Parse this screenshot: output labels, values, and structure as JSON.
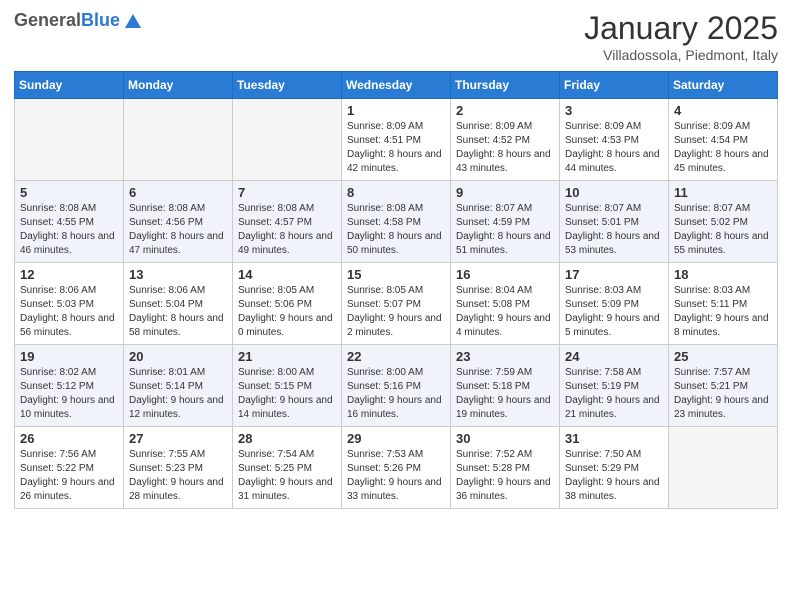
{
  "header": {
    "logo_general": "General",
    "logo_blue": "Blue",
    "title": "January 2025",
    "location": "Villadossola, Piedmont, Italy"
  },
  "days_of_week": [
    "Sunday",
    "Monday",
    "Tuesday",
    "Wednesday",
    "Thursday",
    "Friday",
    "Saturday"
  ],
  "weeks": [
    [
      {
        "day": "",
        "info": ""
      },
      {
        "day": "",
        "info": ""
      },
      {
        "day": "",
        "info": ""
      },
      {
        "day": "1",
        "info": "Sunrise: 8:09 AM\nSunset: 4:51 PM\nDaylight: 8 hours and 42 minutes."
      },
      {
        "day": "2",
        "info": "Sunrise: 8:09 AM\nSunset: 4:52 PM\nDaylight: 8 hours and 43 minutes."
      },
      {
        "day": "3",
        "info": "Sunrise: 8:09 AM\nSunset: 4:53 PM\nDaylight: 8 hours and 44 minutes."
      },
      {
        "day": "4",
        "info": "Sunrise: 8:09 AM\nSunset: 4:54 PM\nDaylight: 8 hours and 45 minutes."
      }
    ],
    [
      {
        "day": "5",
        "info": "Sunrise: 8:08 AM\nSunset: 4:55 PM\nDaylight: 8 hours and 46 minutes."
      },
      {
        "day": "6",
        "info": "Sunrise: 8:08 AM\nSunset: 4:56 PM\nDaylight: 8 hours and 47 minutes."
      },
      {
        "day": "7",
        "info": "Sunrise: 8:08 AM\nSunset: 4:57 PM\nDaylight: 8 hours and 49 minutes."
      },
      {
        "day": "8",
        "info": "Sunrise: 8:08 AM\nSunset: 4:58 PM\nDaylight: 8 hours and 50 minutes."
      },
      {
        "day": "9",
        "info": "Sunrise: 8:07 AM\nSunset: 4:59 PM\nDaylight: 8 hours and 51 minutes."
      },
      {
        "day": "10",
        "info": "Sunrise: 8:07 AM\nSunset: 5:01 PM\nDaylight: 8 hours and 53 minutes."
      },
      {
        "day": "11",
        "info": "Sunrise: 8:07 AM\nSunset: 5:02 PM\nDaylight: 8 hours and 55 minutes."
      }
    ],
    [
      {
        "day": "12",
        "info": "Sunrise: 8:06 AM\nSunset: 5:03 PM\nDaylight: 8 hours and 56 minutes."
      },
      {
        "day": "13",
        "info": "Sunrise: 8:06 AM\nSunset: 5:04 PM\nDaylight: 8 hours and 58 minutes."
      },
      {
        "day": "14",
        "info": "Sunrise: 8:05 AM\nSunset: 5:06 PM\nDaylight: 9 hours and 0 minutes."
      },
      {
        "day": "15",
        "info": "Sunrise: 8:05 AM\nSunset: 5:07 PM\nDaylight: 9 hours and 2 minutes."
      },
      {
        "day": "16",
        "info": "Sunrise: 8:04 AM\nSunset: 5:08 PM\nDaylight: 9 hours and 4 minutes."
      },
      {
        "day": "17",
        "info": "Sunrise: 8:03 AM\nSunset: 5:09 PM\nDaylight: 9 hours and 5 minutes."
      },
      {
        "day": "18",
        "info": "Sunrise: 8:03 AM\nSunset: 5:11 PM\nDaylight: 9 hours and 8 minutes."
      }
    ],
    [
      {
        "day": "19",
        "info": "Sunrise: 8:02 AM\nSunset: 5:12 PM\nDaylight: 9 hours and 10 minutes."
      },
      {
        "day": "20",
        "info": "Sunrise: 8:01 AM\nSunset: 5:14 PM\nDaylight: 9 hours and 12 minutes."
      },
      {
        "day": "21",
        "info": "Sunrise: 8:00 AM\nSunset: 5:15 PM\nDaylight: 9 hours and 14 minutes."
      },
      {
        "day": "22",
        "info": "Sunrise: 8:00 AM\nSunset: 5:16 PM\nDaylight: 9 hours and 16 minutes."
      },
      {
        "day": "23",
        "info": "Sunrise: 7:59 AM\nSunset: 5:18 PM\nDaylight: 9 hours and 19 minutes."
      },
      {
        "day": "24",
        "info": "Sunrise: 7:58 AM\nSunset: 5:19 PM\nDaylight: 9 hours and 21 minutes."
      },
      {
        "day": "25",
        "info": "Sunrise: 7:57 AM\nSunset: 5:21 PM\nDaylight: 9 hours and 23 minutes."
      }
    ],
    [
      {
        "day": "26",
        "info": "Sunrise: 7:56 AM\nSunset: 5:22 PM\nDaylight: 9 hours and 26 minutes."
      },
      {
        "day": "27",
        "info": "Sunrise: 7:55 AM\nSunset: 5:23 PM\nDaylight: 9 hours and 28 minutes."
      },
      {
        "day": "28",
        "info": "Sunrise: 7:54 AM\nSunset: 5:25 PM\nDaylight: 9 hours and 31 minutes."
      },
      {
        "day": "29",
        "info": "Sunrise: 7:53 AM\nSunset: 5:26 PM\nDaylight: 9 hours and 33 minutes."
      },
      {
        "day": "30",
        "info": "Sunrise: 7:52 AM\nSunset: 5:28 PM\nDaylight: 9 hours and 36 minutes."
      },
      {
        "day": "31",
        "info": "Sunrise: 7:50 AM\nSunset: 5:29 PM\nDaylight: 9 hours and 38 minutes."
      },
      {
        "day": "",
        "info": ""
      }
    ]
  ]
}
